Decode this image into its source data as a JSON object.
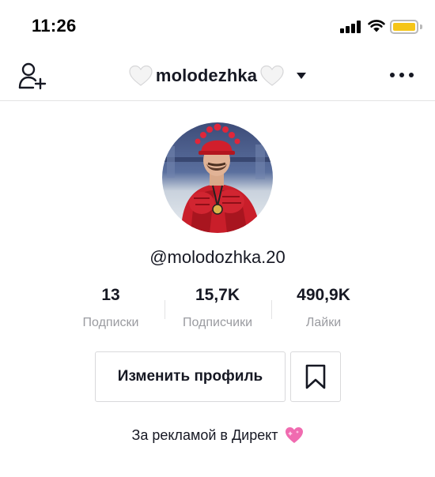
{
  "status_bar": {
    "time": "11:26",
    "battery_color": "#f5c518"
  },
  "header": {
    "username": "molodezhka",
    "left_emoji": "white-heart",
    "right_emoji": "white-heart",
    "add_user_icon": "add-user-icon",
    "more_icon": "more-dots-icon"
  },
  "profile": {
    "handle": "@molodozhka.20",
    "avatar_icon": "profile-photo"
  },
  "stats": [
    {
      "value": "13",
      "label": "Подписки"
    },
    {
      "value": "15,7K",
      "label": "Подписчики"
    },
    {
      "value": "490,9K",
      "label": "Лайки"
    }
  ],
  "actions": {
    "edit_profile_label": "Изменить профиль",
    "bookmark_icon": "bookmark-icon"
  },
  "bio": {
    "text": "За рекламой в Директ",
    "emoji": "pink-sparkling-heart"
  }
}
